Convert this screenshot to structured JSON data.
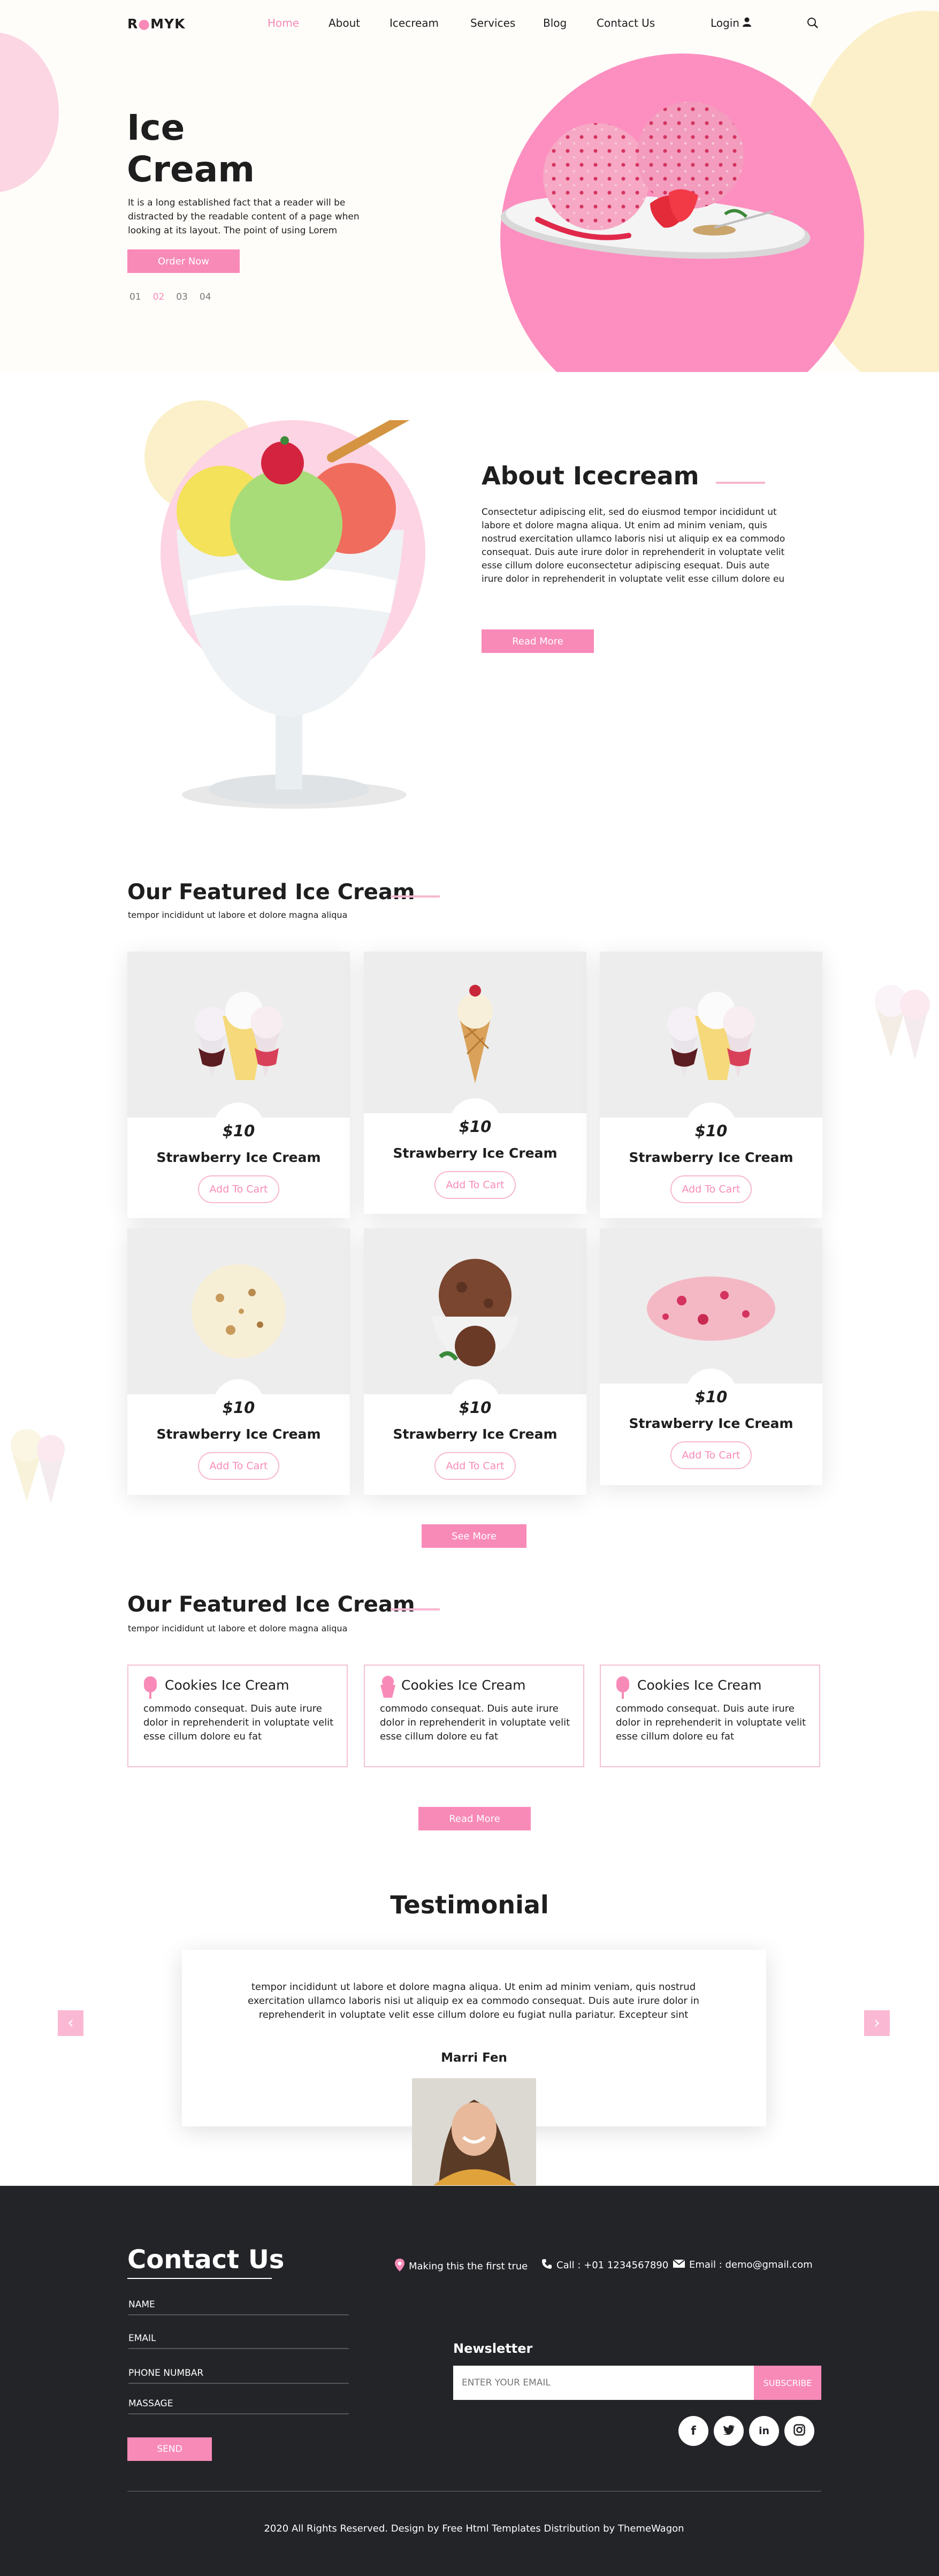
{
  "brand": {
    "logo_prefix": "R",
    "logo_suffix": "MYK",
    "accent_color": "#f88ab8"
  },
  "nav": {
    "items": [
      "Home",
      "About",
      "Icecream",
      "Services",
      "Blog",
      "Contact Us"
    ],
    "active": "Home",
    "login_label": "Login",
    "icons": {
      "user": "user-icon",
      "search": "search-icon"
    }
  },
  "hero": {
    "title_line1": "Ice",
    "title_line2": "Cream",
    "description": "It is a long established fact that a reader will be distracted by the readable content of a page when looking at its layout. The point of using Lorem",
    "cta_label": "Order Now",
    "slides": [
      "01",
      "02",
      "03",
      "04"
    ],
    "active_slide": "02"
  },
  "about": {
    "title": "About Icecream",
    "text": "Consectetur adipiscing elit, sed do eiusmod tempor incididunt ut labore et dolore magna aliqua. Ut enim ad minim veniam, quis nostrud exercitation ullamco laboris nisi ut aliquip ex ea commodo consequat. Duis aute irure dolor in reprehenderit in voluptate velit esse cillum dolore euconsectetur adipiscing esequat. Duis aute irure dolor in reprehenderit in voluptate velit esse cillum dolore eu",
    "button_label": "Read More"
  },
  "featured": {
    "title": "Our Featured Ice Cream",
    "subtitle": "tempor incididunt ut labore et dolore magna aliqua",
    "products": [
      {
        "price": "$10",
        "name": "Strawberry Ice Cream",
        "cart_label": "Add To Cart",
        "image": "ice-cream-cups"
      },
      {
        "price": "$10",
        "name": "Strawberry Ice Cream",
        "cart_label": "Add To Cart",
        "image": "ice-cream-cone"
      },
      {
        "price": "$10",
        "name": "Strawberry Ice Cream",
        "cart_label": "Add To Cart",
        "image": "ice-cream-cups"
      },
      {
        "price": "$10",
        "name": "Strawberry Ice Cream",
        "cart_label": "Add To Cart",
        "image": "vanilla-scoop"
      },
      {
        "price": "$10",
        "name": "Strawberry Ice Cream",
        "cart_label": "Add To Cart",
        "image": "chocolate-bowl"
      },
      {
        "price": "$10",
        "name": "Strawberry Ice Cream",
        "cart_label": "Add To Cart",
        "image": "strawberry-scoop"
      }
    ],
    "see_more_label": "See More"
  },
  "services": {
    "title": "Our Featured Ice Cream",
    "subtitle": "tempor incididunt ut labore et dolore magna aliqua",
    "items": [
      {
        "title": "Cookies Ice Cream",
        "text": "commodo consequat. Duis aute irure dolor in reprehenderit in voluptate velit esse cillum dolore eu fat"
      },
      {
        "title": "Cookies Ice Cream",
        "text": "commodo consequat. Duis aute irure dolor in reprehenderit in voluptate velit esse cillum dolore eu fat"
      },
      {
        "title": "Cookies Ice Cream",
        "text": "commodo consequat. Duis aute irure dolor in reprehenderit in voluptate velit esse cillum dolore eu fat"
      }
    ],
    "read_more_label": "Read More"
  },
  "testimonial": {
    "title": "Testimonial",
    "quote": "tempor incididunt ut labore et dolore magna aliqua. Ut enim ad minim veniam, quis nostrud exercitation ullamco laboris nisi ut aliquip ex ea commodo consequat. Duis aute irure dolor in reprehenderit in voluptate velit esse cillum dolore eu fugiat nulla pariatur. Excepteur sint",
    "author": "Marri Fen",
    "prev_icon": "chevron-left-icon",
    "next_icon": "chevron-right-icon"
  },
  "contact": {
    "title": "Contact Us",
    "fields": [
      "NAME",
      "EMAIL",
      "PHONE NUMBAR",
      "MASSAGE"
    ],
    "send_label": "SEND",
    "location": "Making this the first true",
    "call": "Call : +01 1234567890",
    "email": "Email : demo@gmail.com"
  },
  "newsletter": {
    "title": "Newsletter",
    "placeholder": "ENTER YOUR EMAIL",
    "subscribe_label": "SUBSCRIBE",
    "socials": [
      "facebook-icon",
      "twitter-icon",
      "linkedin-icon",
      "instagram-icon"
    ]
  },
  "footer": {
    "copyright": "2020 All Rights Reserved. Design by Free Html Templates Distribution by ThemeWagon"
  }
}
